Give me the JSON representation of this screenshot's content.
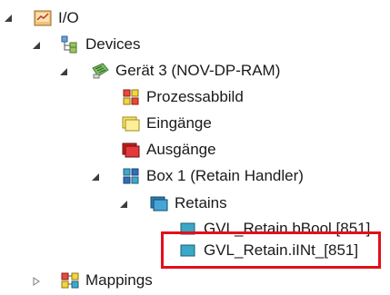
{
  "tree": {
    "io": {
      "label": "I/O"
    },
    "devices": {
      "label": "Devices"
    },
    "device": {
      "label": "Gerät 3 (NOV-DP-RAM)"
    },
    "prozessabbild": {
      "label": "Prozessabbild"
    },
    "eingaenge": {
      "label": "Eingänge"
    },
    "ausgaenge": {
      "label": "Ausgänge"
    },
    "box": {
      "label": "Box 1 (Retain Handler)"
    },
    "retains": {
      "label": "Retains"
    },
    "var_bool": {
      "label": "GVL_Retain.bBool [851]"
    },
    "var_int": {
      "label": "GVL_Retain.iINt_[851]"
    },
    "mappings": {
      "label": "Mappings"
    }
  },
  "colors": {
    "highlight_border": "#e2101b",
    "selection_expanded_arrow": "#3c3c3c"
  },
  "icons": {
    "io": "io-folder-icon",
    "devices": "devices-icon",
    "device": "device-card-icon",
    "prozessabbild": "process-image-icon",
    "eingaenge": "inputs-icon",
    "ausgaenge": "outputs-icon",
    "box": "box-icon",
    "retains": "retains-icon",
    "var": "variable-icon",
    "mappings": "mappings-icon"
  }
}
